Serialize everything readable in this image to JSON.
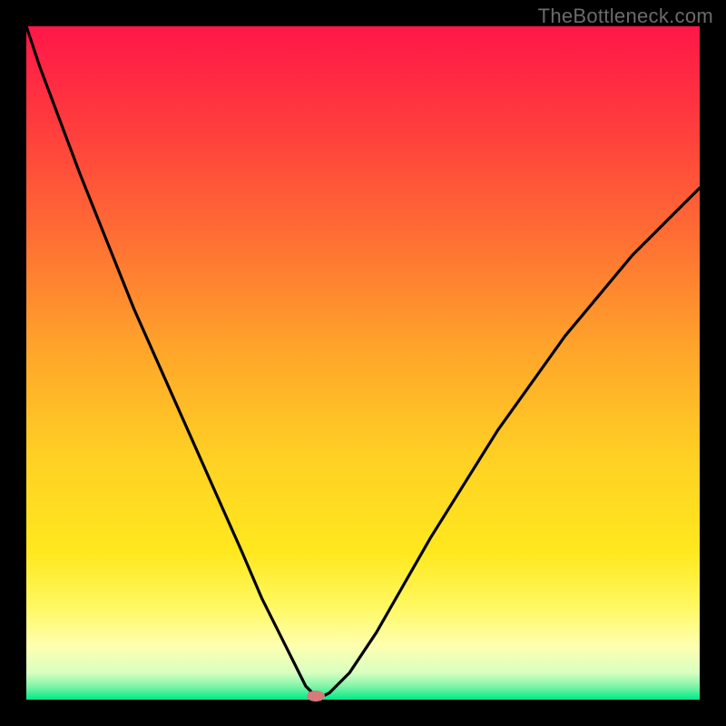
{
  "watermark": "TheBottleneck.com",
  "chart_data": {
    "type": "line",
    "title": "",
    "xlabel": "",
    "ylabel": "",
    "xlim": [
      0,
      100
    ],
    "ylim": [
      0,
      100
    ],
    "grid": false,
    "series": [
      {
        "name": "bottleneck-curve",
        "x": [
          0,
          2,
          5,
          8,
          12,
          16,
          20,
          24,
          28,
          32,
          35,
          38,
          40,
          41.5,
          43,
          44,
          45,
          48,
          52,
          56,
          60,
          65,
          70,
          75,
          80,
          85,
          90,
          95,
          100
        ],
        "y": [
          100,
          94,
          86,
          78,
          68,
          58,
          49,
          40,
          31,
          22,
          15,
          9,
          5,
          2,
          0.5,
          0.5,
          1,
          4,
          10,
          17,
          24,
          32,
          40,
          47,
          54,
          60,
          66,
          71,
          76
        ]
      }
    ],
    "optimal_point": {
      "x": 43,
      "y": 0.5
    },
    "background_gradient": {
      "stops": [
        {
          "pos": 0.0,
          "color": "#ff1748"
        },
        {
          "pos": 0.5,
          "color": "#ffa52a"
        },
        {
          "pos": 0.78,
          "color": "#ffe81e"
        },
        {
          "pos": 0.92,
          "color": "#ffffb0"
        },
        {
          "pos": 1.0,
          "color": "#00e888"
        }
      ]
    }
  }
}
